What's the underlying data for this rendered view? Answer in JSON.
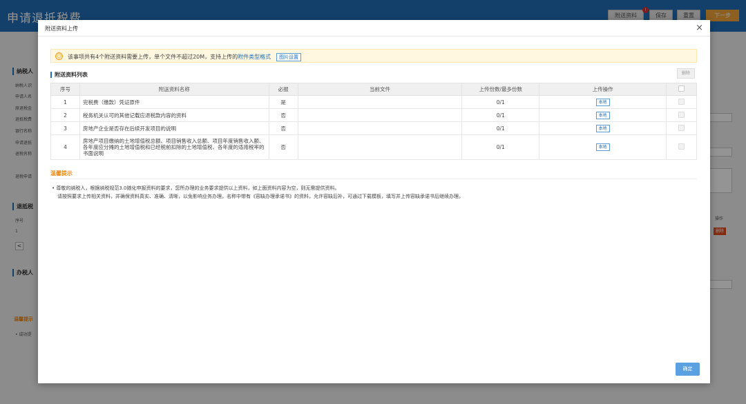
{
  "app": {
    "title": "申请退抵税费",
    "buttons": {
      "attach": "附送资料",
      "save": "保存",
      "reset": "重置",
      "next": "下一步"
    },
    "attach_badge": "!",
    "sections": [
      "纳税人",
      "退抵税",
      "办税人"
    ],
    "row_labels": [
      "纳税人识",
      "申请人名",
      "原退税金",
      "退抵税费",
      "银行名称",
      "申请退抵",
      "退税名称",
      "退税申请"
    ],
    "small_labels": {
      "seq": "序号",
      "one": "1",
      "op": "操作",
      "del": "删除",
      "left_arrow": "<"
    },
    "tip_title": "温馨提示",
    "tip_bullet": "• 成功提"
  },
  "modal": {
    "title": "附送资料上传",
    "close_glyph": "×",
    "notice": {
      "text": "该事项共有4个附送资料需要上传，单个文件不超过20M，支持上传的",
      "link": "附件类型格式",
      "button": "图片设置"
    },
    "section_title": "附送资料列表",
    "delete_button": "删除",
    "table": {
      "headers": [
        "序号",
        "附送资料名称",
        "必报",
        "当前文件",
        "上传份数/最多份数",
        "上传操作"
      ],
      "rows": [
        {
          "seq": "1",
          "name": "完税费（缴款）凭证原件",
          "required": "是",
          "file": "",
          "count": "0/1",
          "action": "本地"
        },
        {
          "seq": "2",
          "name": "税务机关认可的其他记载应退税款内容的资料",
          "required": "否",
          "file": "",
          "count": "0/1",
          "action": "本地"
        },
        {
          "seq": "3",
          "name": "房地产企业是否存在后续开发项目的说明",
          "required": "否",
          "file": "",
          "count": "0/1",
          "action": "本地"
        },
        {
          "seq": "4",
          "name": "房地产项目缴纳的土地增值税总额、项目销售收入总额、项目年度销售收入额、各年度应分摊的土地增值税和已经税前扣除的土地增值税、各年度的适用税率的书面说明",
          "required": "否",
          "file": "",
          "count": "0/1",
          "action": "本地"
        }
      ]
    },
    "tip_title": "温馨提示",
    "tip_lines": [
      "• 尊敬的纳税人，根据纳税规范3.0随化申报资料的要求，您所办理的业务要求提供以上资料，如上面资料内容为空，则无需提供资料。",
      "请按照要求上传相关资料，并确保资料真实、准确、清晰，以免影响业务办理。名称中带有《容缺办理承诺书》的资料，允许容缺后补，可通过下载模板，填写并上传容缺承诺书后继续办理。"
    ],
    "ok_button": "确定"
  }
}
